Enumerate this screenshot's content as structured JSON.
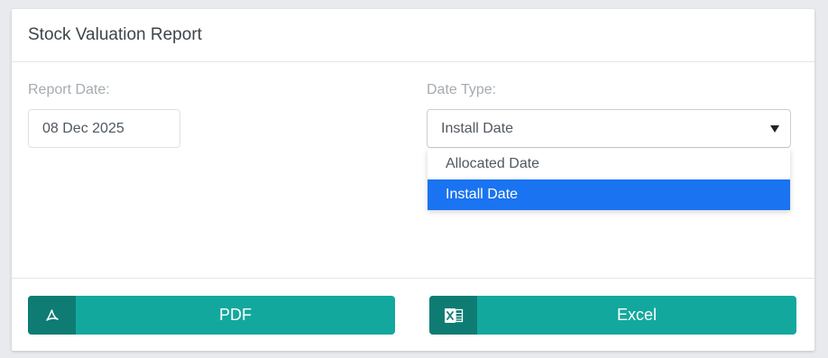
{
  "card": {
    "title": "Stock Valuation Report"
  },
  "report_date": {
    "label": "Report Date:",
    "value": "08 Dec 2025"
  },
  "date_type": {
    "label": "Date Type:",
    "selected": "Install Date",
    "options": [
      "Allocated Date",
      "Install Date"
    ]
  },
  "buttons": {
    "pdf": "PDF",
    "excel": "Excel"
  },
  "colors": {
    "button": "#13a89e",
    "button_icon_bg": "#0e7c73",
    "highlight": "#1a73f0"
  }
}
